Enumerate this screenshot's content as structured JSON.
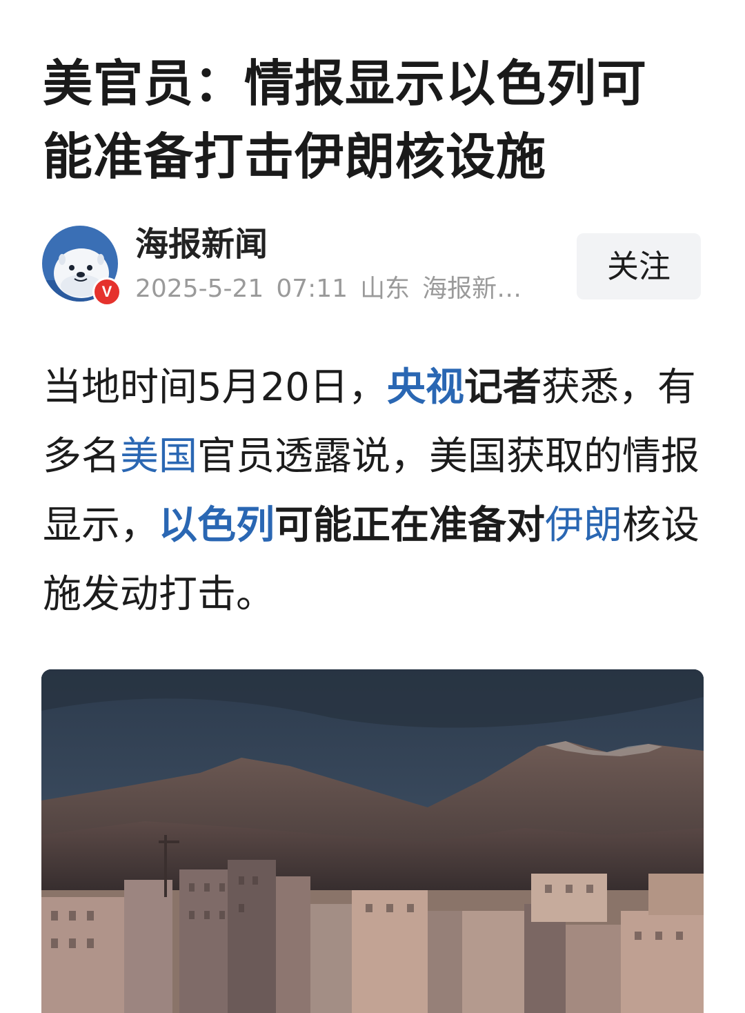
{
  "article": {
    "title": "美官员：情报显示以色列可能准备打击伊朗核设施",
    "author": {
      "name": "海报新闻",
      "verified_badge": "V",
      "date": "2025-5-21",
      "time": "07:11",
      "location": "山东",
      "source": "海报新…"
    },
    "follow_label": "关注",
    "body": {
      "p1": "当地时间5月20日，",
      "link_cctv": "央视",
      "p2": "记者",
      "p3": "获悉，有多名",
      "link_us": "美国",
      "p4": "官员透露说，美国获取的情报显示，",
      "link_israel": "以色列",
      "p5": "可能正在准备对",
      "link_iran": "伊朗",
      "p6": "核设施发动打击。"
    }
  },
  "colors": {
    "link": "#2a67b3",
    "badge": "#e5322d",
    "avatar_bg": "#3a6fb5",
    "follow_bg": "#f2f3f5"
  },
  "icons": {
    "avatar": "seal-mascot-avatar",
    "verified": "verified-v-icon"
  }
}
